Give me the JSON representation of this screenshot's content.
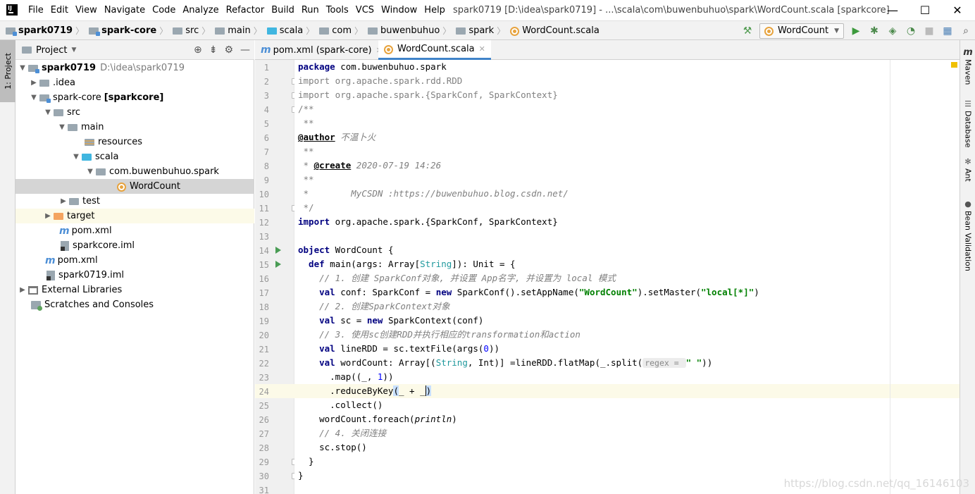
{
  "menubar": {
    "logo_text": "IJ",
    "items": [
      "File",
      "Edit",
      "View",
      "Navigate",
      "Code",
      "Analyze",
      "Refactor",
      "Build",
      "Run",
      "Tools",
      "VCS",
      "Window",
      "Help"
    ],
    "window_title": "spark0719 [D:\\idea\\spark0719] - ...\\scala\\com\\buwenbuhuo\\spark\\WordCount.scala [sparkcore]",
    "controls": {
      "minimize": "—",
      "maximize": "☐",
      "close": "✕"
    }
  },
  "navbar": {
    "breadcrumbs": [
      "spark0719",
      "spark-core",
      "src",
      "main",
      "scala",
      "com",
      "buwenbuhuo",
      "spark",
      "WordCount.scala"
    ],
    "run_config": "WordCount"
  },
  "left_strip": {
    "project_tab": "1: Project"
  },
  "project_panel": {
    "title": "Project",
    "tree": [
      {
        "label": "spark0719",
        "extra": "D:\\idea\\spark0719"
      },
      {
        "label": ".idea"
      },
      {
        "label": "spark-core",
        "extra": "[sparkcore]"
      },
      {
        "label": "src"
      },
      {
        "label": "main"
      },
      {
        "label": "resources"
      },
      {
        "label": "scala"
      },
      {
        "label": "com.buwenbuhuo.spark"
      },
      {
        "label": "WordCount"
      },
      {
        "label": "test"
      },
      {
        "label": "target"
      },
      {
        "label": "pom.xml"
      },
      {
        "label": "sparkcore.iml"
      },
      {
        "label": "pom.xml"
      },
      {
        "label": "spark0719.iml"
      },
      {
        "label": "External Libraries"
      },
      {
        "label": "Scratches and Consoles"
      }
    ]
  },
  "editor_tabs": [
    {
      "label": "pom.xml (spark-core)"
    },
    {
      "label": "WordCount.scala"
    }
  ],
  "editor": {
    "line_numbers": [
      "1",
      "2",
      "3",
      "4",
      "5",
      "6",
      "7",
      "8",
      "9",
      "10",
      "11",
      "12",
      "13",
      "14",
      "15",
      "16",
      "17",
      "18",
      "19",
      "20",
      "21",
      "22",
      "23",
      "24",
      "25",
      "26",
      "27",
      "28",
      "29",
      "30",
      "31"
    ],
    "code": {
      "l1a": "package",
      "l1b": " com.buwenbuhuo.spark",
      "l2a": "import",
      "l2b": " org.apache.spark.rdd.RDD",
      "l3a": "import",
      "l3b": " org.apache.spark.{SparkConf, SparkContext}",
      "l4": "/**",
      "l5": " **",
      "l6a": "@author",
      "l6b": " 不温卜火",
      "l7": " **",
      "l8a": " * ",
      "l8b": "@create",
      "l8c": " 2020-07-19 14:26",
      "l9": " **",
      "l10": " *        MyCSDN :https://buwenbuhuo.blog.csdn.net/",
      "l11": " */",
      "l13a": "import",
      "l13b": " org.apache.spark.{SparkConf, SparkContext}",
      "l15a": "object",
      "l15b": " WordCount {",
      "l16a": "  def",
      "l16b": " main(args: Array[",
      "l16c": "String",
      "l16d": "]): Unit = {",
      "l17": "    // 1. 创建 SparkConf对象, 并设置 App名字, 并设置为 local 模式",
      "l18a": "    val",
      "l18b": " conf: SparkConf = ",
      "l18c": "new",
      "l18d": " SparkConf().setAppName(",
      "l18e": "\"WordCount\"",
      "l18f": ").setMaster(",
      "l18g": "\"local[*]\"",
      "l18h": ")",
      "l19": "    // 2. 创建SparkContext对象",
      "l20a": "    val",
      "l20b": " sc = ",
      "l20c": "new",
      "l20d": " SparkContext(conf)",
      "l21": "    // 3. 使用sc创建RDD并执行相应的transformation和action",
      "l22a": "    val",
      "l22b": " lineRDD = sc.textFile(args(",
      "l22c": "0",
      "l22d": "))",
      "l23a": "    val",
      "l23b": " wordCount: Array[(",
      "l23c": "String",
      "l23d": ", Int)] =lineRDD.flatMap(_.split(",
      "l23e": "regex = ",
      "l23f": "\" \"",
      "l23g": "))",
      "l24a": "      .map((_, ",
      "l24b": "1",
      "l24c": "))",
      "l25a": "      .reduceByKey",
      "l25b": "(",
      "l25c": "_ + _",
      "l25d": ")",
      "l26": "      .collect()",
      "l27a": "    wordCount.foreach(",
      "l27b": "println",
      "l27c": ")",
      "l28": "    // 4. 关闭连接",
      "l29": "    sc.stop()",
      "l30": "  }",
      "l31": "}"
    }
  },
  "right_strip": [
    "Maven",
    "Database",
    "Ant",
    "Bean Validation"
  ],
  "watermark": "https://blog.csdn.net/qq_16146103",
  "colors": {
    "keyword": "#000080",
    "string": "#008000",
    "number": "#0000ff",
    "comment": "#808080",
    "accent": "#4083c9",
    "current_line": "#fcfae8"
  },
  "icons": [
    "intellij-logo-icon",
    "folder-icon",
    "module-folder-icon",
    "source-folder-icon",
    "scala-file-icon",
    "maven-icon",
    "run-icon",
    "debug-icon",
    "build-hammer-icon",
    "coverage-icon",
    "profile-icon",
    "stop-icon",
    "project-structure-icon",
    "search-everywhere-icon",
    "gear-icon",
    "minus-icon",
    "crosshair-icon",
    "collapse-icon"
  ]
}
